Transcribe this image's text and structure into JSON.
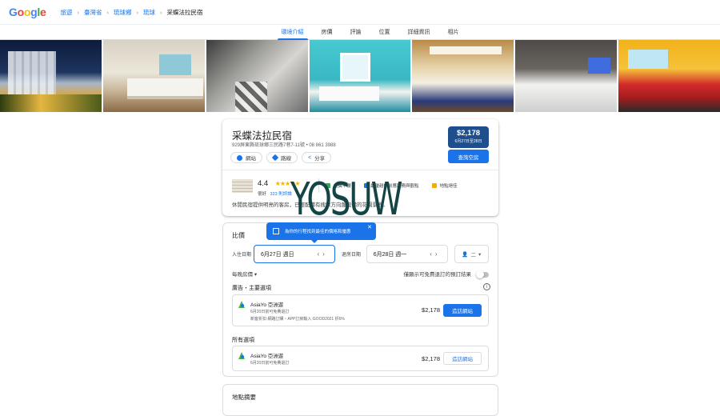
{
  "header": {
    "logo": "Google",
    "breadcrumbs": [
      "旅遊",
      "臺灣省",
      "琉球鄉",
      "琉球"
    ],
    "current": "采蝶法拉民宿"
  },
  "tabs": [
    {
      "label": "環境介紹",
      "active": true
    },
    {
      "label": "房價",
      "active": false
    },
    {
      "label": "評論",
      "active": false
    },
    {
      "label": "位置",
      "active": false
    },
    {
      "label": "詳細資訊",
      "active": false
    },
    {
      "label": "相片",
      "active": false
    }
  ],
  "hotel": {
    "name": "采蝶法拉民宿",
    "address": "929屏東縣琉球鄉三民路7巷7-11號 • 08 861 3988",
    "actions": {
      "website": "網站",
      "directions": "路線",
      "share": "分享"
    },
    "price": "$2,178",
    "price_dates": "6月27日至28日",
    "check_button": "查詢空房",
    "rating": "4.4",
    "rating_word": "很好",
    "reviews_link": "323 則評論",
    "amenities": [
      "免費早餐",
      "最優越的前應服務與觀點",
      "地點絕佳"
    ],
    "description": "休閒民宿提供明亮的客房，已經配備有搜索方向盤設備的花園景觀。",
    "stars": "★★★★★"
  },
  "watermark": "YOSUW",
  "pricing": {
    "title": "比價",
    "tooltip": "為你的行程找到最佳的價格和優惠",
    "checkin_label": "入住日期",
    "checkin_value": "6月27日 週日",
    "checkout_label": "退房日期",
    "checkout_value": "6月28日 週一",
    "guests": "二",
    "nightly_label": "每晚房價",
    "free_cancel_label": "僅顯示可免費退訂的預訂結果",
    "ads_title": "廣告・主要選項",
    "all_title": "所有選項",
    "ad_offer": {
      "name": "AsiaYo 亞洲遊",
      "line1": "6月20日前可免費退訂",
      "line2": "新客折扣 網路訂購・APP訂房輸入 GOOD2021 折6%",
      "price": "$2,178",
      "button": "造訪網站"
    },
    "offer": {
      "name": "AsiaYo 亞洲遊",
      "line1": "6月20日前可免費退訂",
      "price": "$2,178",
      "button": "造訪網站"
    }
  },
  "map_section": {
    "title": "地點摘要"
  },
  "colors": {
    "accent": "#1a73e8",
    "price_box": "#1e4e8c",
    "star": "#f4b400"
  }
}
